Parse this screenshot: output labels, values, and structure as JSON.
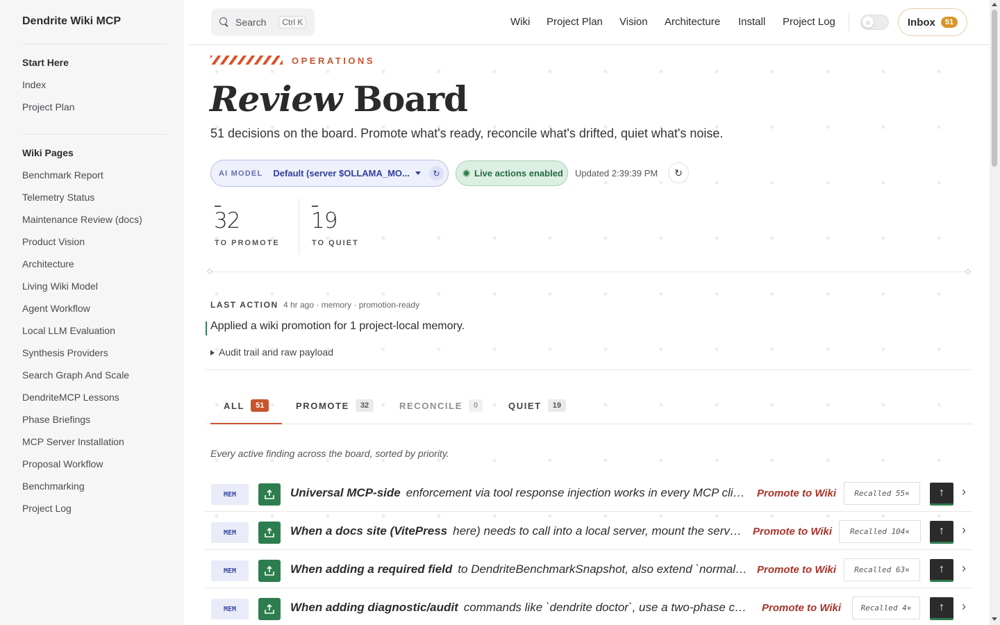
{
  "sidebar": {
    "brand": "Dendrite Wiki MCP",
    "sections": [
      {
        "title": "Start Here",
        "items": [
          "Index",
          "Project Plan"
        ]
      },
      {
        "title": "Wiki Pages",
        "items": [
          "Benchmark Report",
          "Telemetry Status",
          "Maintenance Review (docs)",
          "Product Vision",
          "Architecture",
          "Living Wiki Model",
          "Agent Workflow",
          "Local LLM Evaluation",
          "Synthesis Providers",
          "Search Graph And Scale",
          "DendriteMCP Lessons",
          "Phase Briefings",
          "MCP Server Installation",
          "Proposal Workflow",
          "Benchmarking",
          "Project Log"
        ]
      }
    ]
  },
  "header": {
    "search_label": "Search",
    "search_kbd": "Ctrl K",
    "nav": [
      "Wiki",
      "Project Plan",
      "Vision",
      "Architecture",
      "Install",
      "Project Log"
    ],
    "inbox_label": "Inbox",
    "inbox_count": "51",
    "theme_icon": "sun-icon"
  },
  "hero": {
    "eyebrow": "OPERATIONS",
    "title_italic": "Review",
    "title_rest": "Board",
    "subtitle": "51 decisions on the board. Promote what's ready, reconcile what's drifted, quiet what's noise."
  },
  "controls": {
    "model_tag": "AI MODEL",
    "model_value": "Default (server $OLLAMA_MO...",
    "live_label": "Live actions enabled",
    "updated": "Updated 2:39:39 PM"
  },
  "stats": [
    {
      "value": "32",
      "label": "TO PROMOTE"
    },
    {
      "value": "19",
      "label": "TO QUIET"
    }
  ],
  "last_action": {
    "label": "LAST ACTION",
    "meta": "4 hr ago · memory · promotion-ready",
    "text": "Applied a wiki promotion for 1 project-local memory.",
    "audit": "Audit trail and raw payload"
  },
  "tabs": [
    {
      "label": "ALL",
      "count": "51"
    },
    {
      "label": "PROMOTE",
      "count": "32"
    },
    {
      "label": "RECONCILE",
      "count": "0"
    },
    {
      "label": "QUIET",
      "count": "19"
    }
  ],
  "hint": "Every active finding across the board, sorted by priority.",
  "findings": [
    {
      "tag": "MEM",
      "lead": "Universal MCP-side",
      "rest": "enforcement via tool response injection works in every MCP clien...",
      "action": "Promote to Wiki",
      "recalled": "Recalled 55×"
    },
    {
      "tag": "MEM",
      "lead": "When a docs site (VitePress",
      "rest": "here) needs to call into a local server, mount the server'...",
      "action": "Promote to Wiki",
      "recalled": "Recalled 104×"
    },
    {
      "tag": "MEM",
      "lead": "When adding a required field",
      "rest": "to DendriteBenchmarkSnapshot, also extend `normalize...",
      "action": "Promote to Wiki",
      "recalled": "Recalled 63×"
    },
    {
      "tag": "MEM",
      "lead": "When adding diagnostic/audit",
      "rest": "commands like `dendrite doctor`, use a two-phase che...",
      "action": "Promote to Wiki",
      "recalled": "Recalled 4×"
    }
  ],
  "colors": {
    "accent": "#c9542e",
    "promote_text": "#a8332a",
    "action_green": "#2e7d4f",
    "model_blue": "#303f9f"
  }
}
